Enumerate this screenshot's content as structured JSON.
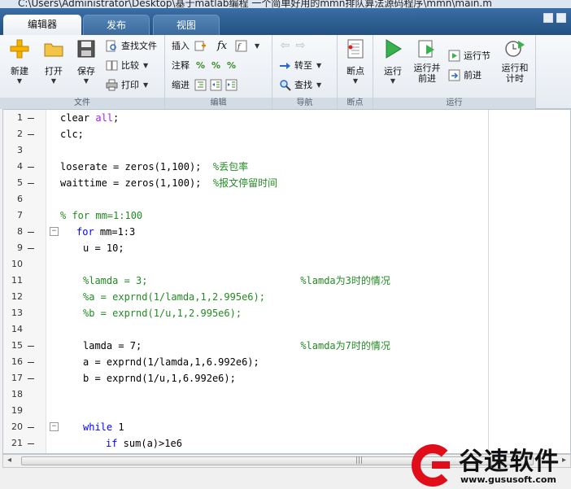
{
  "window": {
    "title": "C:\\Users\\Administrator\\Desktop\\基于matlab编程 一个简单好用的mmn排队算法源码程序\\mmn\\main.m"
  },
  "tabs": [
    {
      "label": "编辑器",
      "active": true
    },
    {
      "label": "发布",
      "active": false
    },
    {
      "label": "视图",
      "active": false
    }
  ],
  "ribbon": {
    "file": {
      "group_label": "文件",
      "new_label": "新建",
      "open_label": "打开",
      "save_label": "保存",
      "find_files_label": "查找文件",
      "compare_label": "比较",
      "print_label": "打印"
    },
    "edit": {
      "group_label": "编辑",
      "insert_label": "插入",
      "comment_label": "注释",
      "indent_label": "缩进",
      "fx_label": "fx"
    },
    "navigate": {
      "group_label": "导航",
      "goto_label": "转至",
      "find_label": "查找"
    },
    "breakpoints": {
      "group_label": "断点",
      "breakpoints_label": "断点"
    },
    "run": {
      "group_label": "运行",
      "run_label": "运行",
      "run_advance_label": "运行并\n前进",
      "run_section_label": "运行节",
      "advance_label": "前进",
      "run_time_label": "运行和\n计时"
    }
  },
  "editor": {
    "lines": [
      {
        "n": "1",
        "mark": true,
        "indent": 30,
        "segments": [
          {
            "t": "clear ",
            "c": "plain"
          },
          {
            "t": "all",
            "c": "str"
          },
          {
            "t": ";",
            "c": "plain"
          }
        ]
      },
      {
        "n": "2",
        "mark": true,
        "indent": 30,
        "segments": [
          {
            "t": "clc;",
            "c": "plain"
          }
        ]
      },
      {
        "n": "3",
        "mark": false,
        "indent": 30,
        "segments": []
      },
      {
        "n": "4",
        "mark": true,
        "indent": 30,
        "segments": [
          {
            "t": "loserate = zeros(1,100);  ",
            "c": "plain"
          },
          {
            "t": "%丢包率",
            "c": "cm"
          }
        ]
      },
      {
        "n": "5",
        "mark": true,
        "indent": 30,
        "segments": [
          {
            "t": "waittime = zeros(1,100);  ",
            "c": "plain"
          },
          {
            "t": "%报文停留时间",
            "c": "cm"
          }
        ]
      },
      {
        "n": "6",
        "mark": false,
        "indent": 30,
        "segments": []
      },
      {
        "n": "7",
        "mark": false,
        "indent": 30,
        "segments": [
          {
            "t": "% for mm=1:100",
            "c": "cm"
          }
        ]
      },
      {
        "n": "8",
        "mark": true,
        "fold": true,
        "indent": 50,
        "segments": [
          {
            "t": "for",
            "c": "kw"
          },
          {
            "t": " mm=1:3",
            "c": "plain"
          }
        ]
      },
      {
        "n": "9",
        "mark": true,
        "indent": 58,
        "segments": [
          {
            "t": "u = 10;",
            "c": "plain"
          }
        ]
      },
      {
        "n": "10",
        "mark": false,
        "indent": 58,
        "segments": []
      },
      {
        "n": "11",
        "mark": false,
        "indent": 58,
        "segments": [
          {
            "t": "%lamda = 3;                          %lamda为3时的情况",
            "c": "cm"
          }
        ]
      },
      {
        "n": "12",
        "mark": false,
        "indent": 58,
        "segments": [
          {
            "t": "%a = exprnd(1/lamda,1,2.995e6);",
            "c": "cm"
          }
        ]
      },
      {
        "n": "13",
        "mark": false,
        "indent": 58,
        "segments": [
          {
            "t": "%b = exprnd(1/u,1,2.995e6);",
            "c": "cm"
          }
        ]
      },
      {
        "n": "14",
        "mark": false,
        "indent": 58,
        "segments": []
      },
      {
        "n": "15",
        "mark": true,
        "indent": 58,
        "segments": [
          {
            "t": "lamda = 7;                           ",
            "c": "plain"
          },
          {
            "t": "%lamda为7时的情况",
            "c": "cm"
          }
        ]
      },
      {
        "n": "16",
        "mark": true,
        "indent": 58,
        "segments": [
          {
            "t": "a = exprnd(1/lamda,1,6.992e6);",
            "c": "plain"
          }
        ]
      },
      {
        "n": "17",
        "mark": true,
        "indent": 58,
        "segments": [
          {
            "t": "b = exprnd(1/u,1,6.992e6);",
            "c": "plain"
          }
        ]
      },
      {
        "n": "18",
        "mark": false,
        "indent": 58,
        "segments": []
      },
      {
        "n": "19",
        "mark": false,
        "indent": 58,
        "segments": []
      },
      {
        "n": "20",
        "mark": true,
        "fold": true,
        "indent": 58,
        "segments": [
          {
            "t": "while",
            "c": "kw"
          },
          {
            "t": " 1",
            "c": "plain"
          }
        ]
      },
      {
        "n": "21",
        "mark": true,
        "indent": 86,
        "segments": [
          {
            "t": "if",
            "c": "kw"
          },
          {
            "t": " sum(a)>1e6",
            "c": "plain"
          }
        ]
      }
    ]
  },
  "scrollbar": {
    "grip": "|||"
  },
  "watermark": {
    "brand": "谷速软件",
    "url": "www.gususoft.com"
  },
  "colors": {
    "tab_bar": "#2f5f8f",
    "keyword": "#0000ff",
    "string": "#a020f0",
    "comment": "#228b22",
    "watermark_red": "#e10e19"
  }
}
